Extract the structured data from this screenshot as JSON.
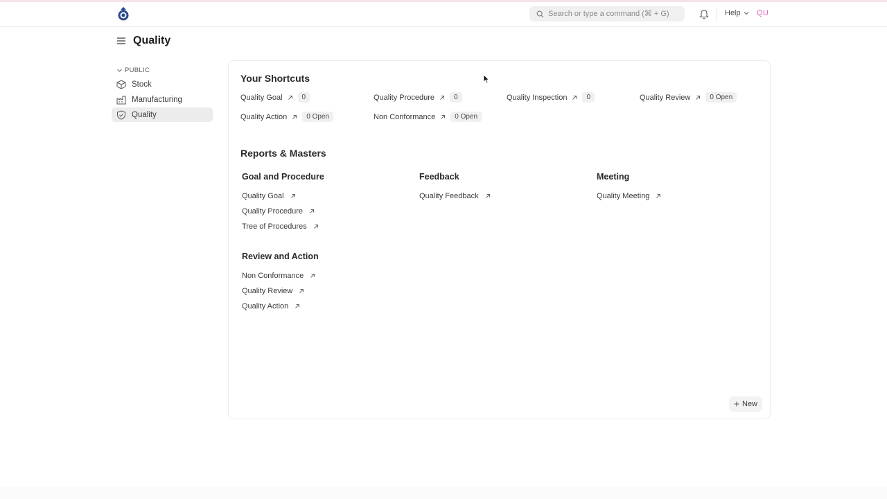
{
  "navbar": {
    "search_placeholder": "Search or type a command (⌘ + G)",
    "help_label": "Help",
    "user_initials": "QU"
  },
  "page": {
    "title": "Quality"
  },
  "sidebar": {
    "section_label": "PUBLIC",
    "items": [
      {
        "label": "Stock",
        "icon": "box-icon"
      },
      {
        "label": "Manufacturing",
        "icon": "factory-icon"
      },
      {
        "label": "Quality",
        "icon": "shield-icon",
        "active": true
      }
    ]
  },
  "shortcuts": {
    "title": "Your Shortcuts",
    "items": [
      {
        "label": "Quality Goal",
        "count": "0"
      },
      {
        "label": "Quality Procedure",
        "count": "0"
      },
      {
        "label": "Quality Inspection",
        "count": "0"
      },
      {
        "label": "Quality Review",
        "count": "0 Open"
      },
      {
        "label": "Quality Action",
        "count": "0 Open"
      },
      {
        "label": "Non Conformance",
        "count": "0 Open"
      }
    ]
  },
  "reports": {
    "title": "Reports & Masters",
    "groups": [
      {
        "title": "Goal and Procedure",
        "links": [
          "Quality Goal",
          "Quality Procedure",
          "Tree of Procedures"
        ]
      },
      {
        "title": "Feedback",
        "links": [
          "Quality Feedback"
        ]
      },
      {
        "title": "Meeting",
        "links": [
          "Quality Meeting"
        ]
      },
      {
        "title": "Review and Action",
        "links": [
          "Non Conformance",
          "Quality Review",
          "Quality Action"
        ]
      }
    ]
  },
  "new_button_label": "New",
  "colors": {
    "accent_user": "#e05fbf",
    "active_bg": "#ececec"
  }
}
